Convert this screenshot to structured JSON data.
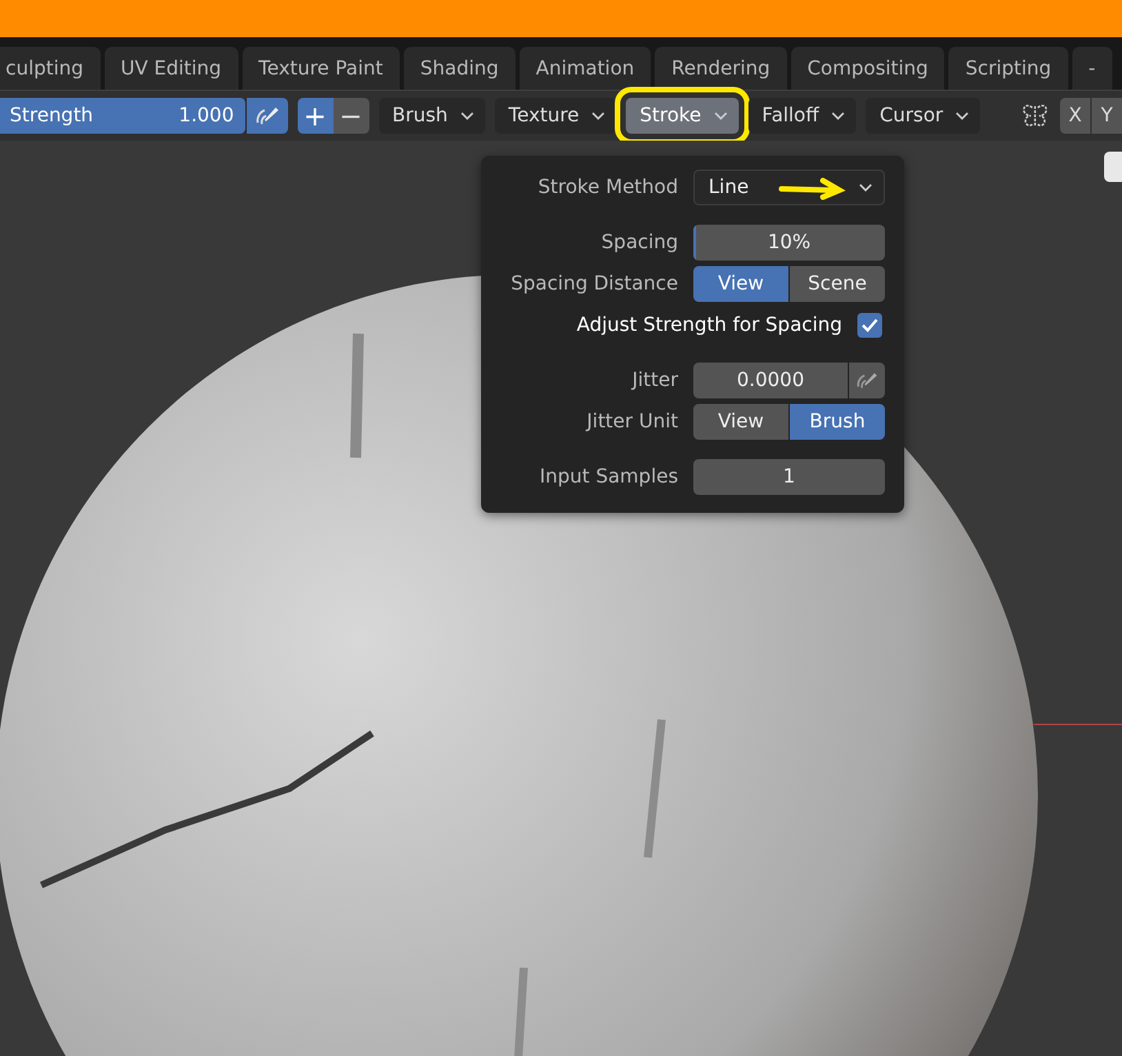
{
  "tabs": [
    {
      "label": "culpting",
      "selected": false
    },
    {
      "label": "UV Editing",
      "selected": false
    },
    {
      "label": "Texture Paint",
      "selected": false
    },
    {
      "label": "Shading",
      "selected": false
    },
    {
      "label": "Animation",
      "selected": false
    },
    {
      "label": "Rendering",
      "selected": false
    },
    {
      "label": "Compositing",
      "selected": false
    },
    {
      "label": "Scripting",
      "selected": false
    },
    {
      "label": "-",
      "selected": false
    }
  ],
  "toolbar": {
    "strength": {
      "label": "Strength",
      "value": "1.000",
      "level": 1
    },
    "direction": [
      {
        "label": "+",
        "selected": true
      },
      {
        "label": "−",
        "selected": false
      }
    ],
    "menus": [
      {
        "label": "Brush",
        "selected": false
      },
      {
        "label": "Texture",
        "selected": false
      },
      {
        "label": "Stroke",
        "selected": true
      },
      {
        "label": "Falloff",
        "selected": false
      },
      {
        "label": "Cursor",
        "selected": false
      }
    ],
    "axes": [
      "X",
      "Y"
    ]
  },
  "stroke_panel": {
    "rows": [
      {
        "kind": "dropdown",
        "label": "Stroke Method",
        "value": "Line"
      },
      {
        "kind": "slider",
        "label": "Spacing",
        "value": "10%",
        "level": 0.01
      },
      {
        "kind": "toggle",
        "label": "Spacing Distance",
        "options": [
          {
            "label": "View",
            "selected": true
          },
          {
            "label": "Scene",
            "selected": false
          }
        ]
      },
      {
        "kind": "checkbox",
        "label": "Adjust Strength for Spacing",
        "checked": true
      },
      {
        "kind": "number",
        "label": "Jitter",
        "value": "0.0000"
      },
      {
        "kind": "toggle",
        "label": "Jitter Unit",
        "options": [
          {
            "label": "View",
            "selected": false
          },
          {
            "label": "Brush",
            "selected": true
          }
        ]
      },
      {
        "kind": "field",
        "label": "Input Samples",
        "value": "1"
      }
    ]
  }
}
